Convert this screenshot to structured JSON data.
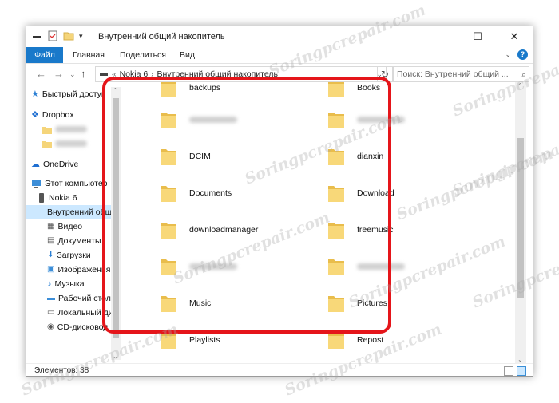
{
  "window": {
    "title": "Внутренний общий накопитель",
    "controls": {
      "minimize": "—",
      "maximize": "☐",
      "close": "✕"
    }
  },
  "ribbon": {
    "tabs": [
      "Файл",
      "Главная",
      "Поделиться",
      "Вид"
    ],
    "help": "?"
  },
  "address": {
    "overflow": "«",
    "segments": [
      "Nokia 6",
      "Внутренний общий накопитель"
    ],
    "search_placeholder": "Поиск: Внутренний общий ..."
  },
  "nav": {
    "items": [
      {
        "label": "Быстрый доступ",
        "icon": "star-icon"
      },
      {
        "label": "Dropbox",
        "icon": "dropbox-icon"
      },
      {
        "label": "",
        "icon": "folder-icon"
      },
      {
        "label": "",
        "icon": "folder-icon"
      },
      {
        "label": "OneDrive",
        "icon": "onedrive-icon"
      },
      {
        "label": "Этот компьютер",
        "icon": "computer-icon"
      },
      {
        "label": "Nokia 6",
        "icon": "phone-icon"
      },
      {
        "label": "Внутренний общий накопитель",
        "icon": "drive-icon"
      },
      {
        "label": "Видео",
        "icon": "video-icon"
      },
      {
        "label": "Документы",
        "icon": "documents-icon"
      },
      {
        "label": "Загрузки",
        "icon": "downloads-icon"
      },
      {
        "label": "Изображения",
        "icon": "pictures-icon"
      },
      {
        "label": "Музыка",
        "icon": "music-icon"
      },
      {
        "label": "Рабочий стол",
        "icon": "desktop-icon"
      },
      {
        "label": "Локальный диск",
        "icon": "disk-icon"
      },
      {
        "label": "CD-дисковод",
        "icon": "cd-icon"
      }
    ]
  },
  "folders": {
    "left": [
      "backups",
      "",
      "DCIM",
      "Documents",
      "downloadmanager",
      "",
      "Music",
      "Playlists"
    ],
    "right": [
      "Books",
      "",
      "dianxin",
      "Download",
      "freemusic",
      "",
      "Pictures",
      "Repost"
    ]
  },
  "status": {
    "items_count": "Элементов: 38"
  },
  "watermark": "Soringpcrepair.com",
  "colors": {
    "accent": "#1979ca",
    "highlight": "#e5151a",
    "folder": "#f5d57a",
    "selection": "#cce8ff"
  }
}
